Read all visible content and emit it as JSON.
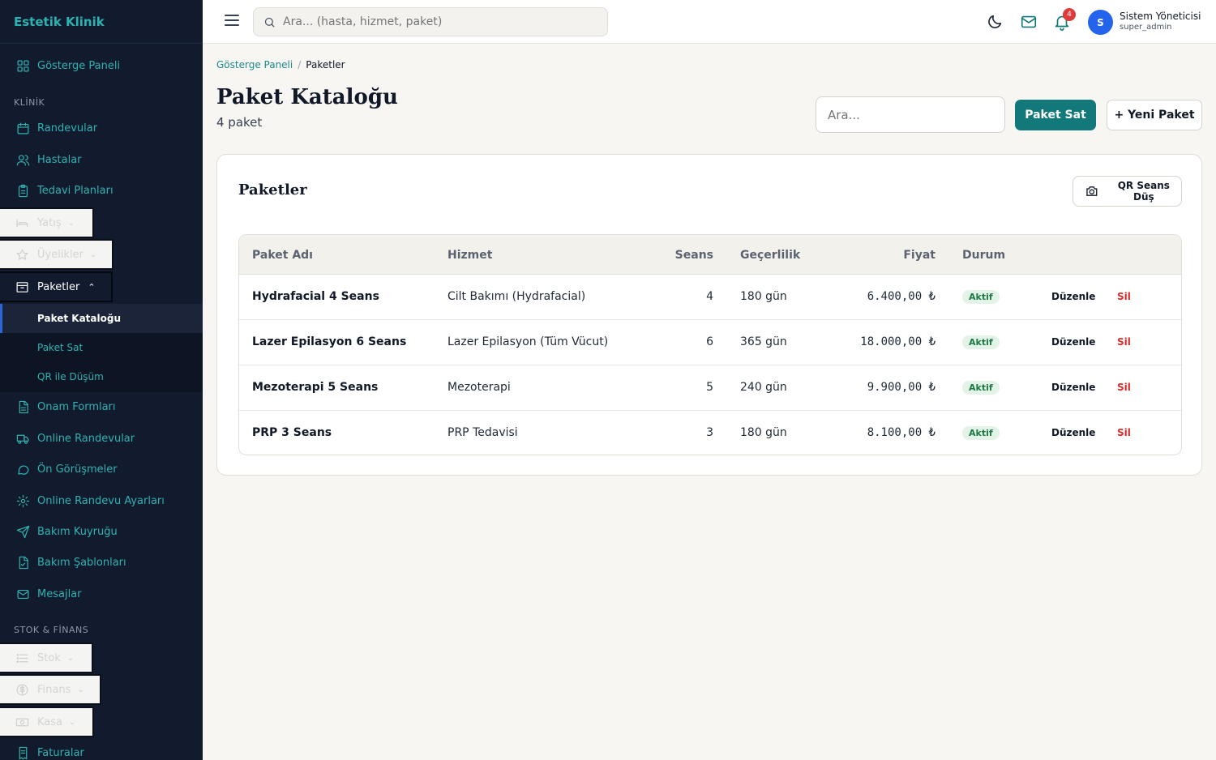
{
  "sidebar": {
    "brand": "Estetik Klinik",
    "dashboard": "Gösterge Paneli",
    "section_clinic": "KLİNİK",
    "appointments": "Randevular",
    "patients": "Hastalar",
    "treatment_plans": "Tedavi Planları",
    "inpatient": "Yatış",
    "memberships": "Üyelikler",
    "packages": "Paketler",
    "package_sub": [
      "Paket Kataloğu",
      "Paket Sat",
      "QR ile Düşüm"
    ],
    "consent_forms": "Onam Formları",
    "online_appointments": "Online Randevular",
    "pre_consults": "Ön Görüşmeler",
    "online_settings": "Online Randevu Ayarları",
    "care_queue": "Bakım Kuyruğu",
    "care_templates": "Bakım Şablonları",
    "messages": "Mesajlar",
    "section_stock": "STOK & FİNANS",
    "stock": "Stok",
    "finance": "Finans",
    "cashbox": "Kasa",
    "invoices": "Faturalar"
  },
  "topbar": {
    "search_placeholder": "Ara... (hasta, hizmet, paket)",
    "notification_count": "4",
    "avatar_initial": "S",
    "user_name": "Sistem Yöneticisi",
    "user_role": "super_admin"
  },
  "breadcrumb": {
    "parent": "Gösterge Paneli",
    "separator": "/",
    "current": "Paketler"
  },
  "page": {
    "title": "Paket Kataloğu",
    "subtitle": "4 paket",
    "search_placeholder": "Ara...",
    "sell_button": "Paket Sat",
    "new_button": "+ Yeni Paket"
  },
  "card": {
    "title": "Paketler",
    "qr_button": "QR Seans Düş",
    "columns": [
      "Paket Adı",
      "Hizmet",
      "Seans",
      "Geçerlilik",
      "Fiyat",
      "Durum"
    ],
    "rows": [
      {
        "name": "Hydrafacial 4 Seans",
        "service": "Cilt Bakımı (Hydrafacial)",
        "sessions": "4",
        "validity": "180 gün",
        "price": "6.400,00 ₺",
        "status": "Aktif",
        "edit": "Düzenle",
        "delete": "Sil"
      },
      {
        "name": "Lazer Epilasyon 6 Seans",
        "service": "Lazer Epilasyon (Tüm Vücut)",
        "sessions": "6",
        "validity": "365 gün",
        "price": "18.000,00 ₺",
        "status": "Aktif",
        "edit": "Düzenle",
        "delete": "Sil"
      },
      {
        "name": "Mezoterapi 5 Seans",
        "service": "Mezoterapi",
        "sessions": "5",
        "validity": "240 gün",
        "price": "9.900,00 ₺",
        "status": "Aktif",
        "edit": "Düzenle",
        "delete": "Sil"
      },
      {
        "name": "PRP 3 Seans",
        "service": "PRP Tedavisi",
        "sessions": "3",
        "validity": "180 gün",
        "price": "8.100,00 ₺",
        "status": "Aktif",
        "edit": "Düzenle",
        "delete": "Sil"
      }
    ]
  },
  "colors": {
    "accent": "#12787a",
    "sidebar_bg": "#121b2e",
    "sidebar_link": "#2fb2b0",
    "danger": "#d92d2d",
    "badge": "#e03b3b",
    "avatar": "#2463eb"
  }
}
